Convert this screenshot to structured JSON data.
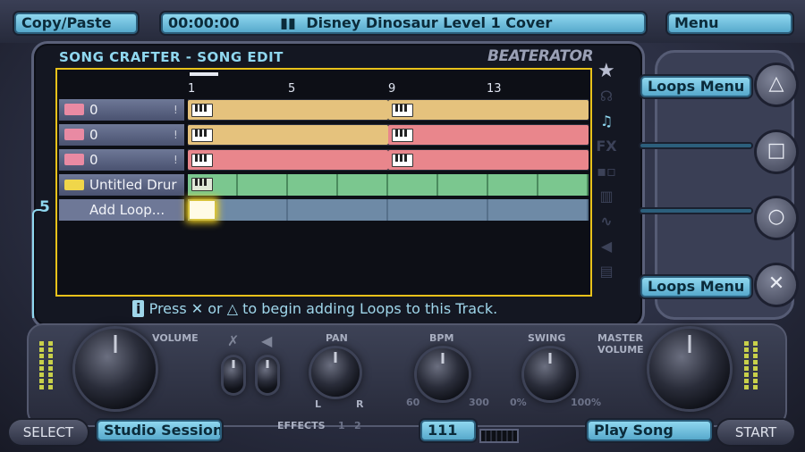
{
  "topbar": {
    "copy_paste": "Copy/Paste",
    "timecode": "00:00:00",
    "song_title": "Disney Dinosaur Level 1 Cover",
    "menu": "Menu"
  },
  "screen": {
    "title": "SONG CRAFTER - SONG EDIT",
    "brand": "BEATERATOR",
    "ruler": [
      "1",
      "5",
      "9",
      "13"
    ],
    "tracks": [
      {
        "label": "0",
        "type": "instrument",
        "clip_colors": [
          "#e5c27d",
          "#e5c27d"
        ]
      },
      {
        "label": "0",
        "type": "instrument",
        "clip_colors": [
          "#e5c27d",
          "#e9868c"
        ]
      },
      {
        "label": "0",
        "type": "instrument",
        "clip_colors": [
          "#e9868c",
          "#e9868c"
        ]
      },
      {
        "label": "Untitled Drur",
        "type": "drum",
        "clip_colors": [
          "#7bc78f"
        ]
      }
    ],
    "add_loop": "Add Loop...",
    "track_number": "5",
    "hint": "Press ✕ or △ to begin adding Loops to this Track."
  },
  "right_panel": {
    "triangle_label": "Loops Menu",
    "square_label": "",
    "circle_label": "",
    "cross_label": "Loops Menu"
  },
  "controls": {
    "volume_label": "VOLUME",
    "pan_label": "PAN",
    "pan_left": "L",
    "pan_right": "R",
    "bpm_label": "BPM",
    "bpm_min": "60",
    "bpm_max": "300",
    "swing_label": "SWING",
    "swing_min": "0%",
    "swing_max": "100%",
    "master_label": "MASTER\nVOLUME",
    "effects_label": "EFFECTS",
    "effects_1": "1",
    "effects_2": "2",
    "bpm_value": "111"
  },
  "bottombar": {
    "select": "SELECT",
    "studio_session": "Studio Session",
    "play_song": "Play Song",
    "start": "START"
  },
  "colors": {
    "accent": "#8fd7ef",
    "selection": "#e8c21a",
    "clip_tan": "#e5c27d",
    "clip_red": "#e9868c",
    "clip_green": "#7bc78f"
  }
}
